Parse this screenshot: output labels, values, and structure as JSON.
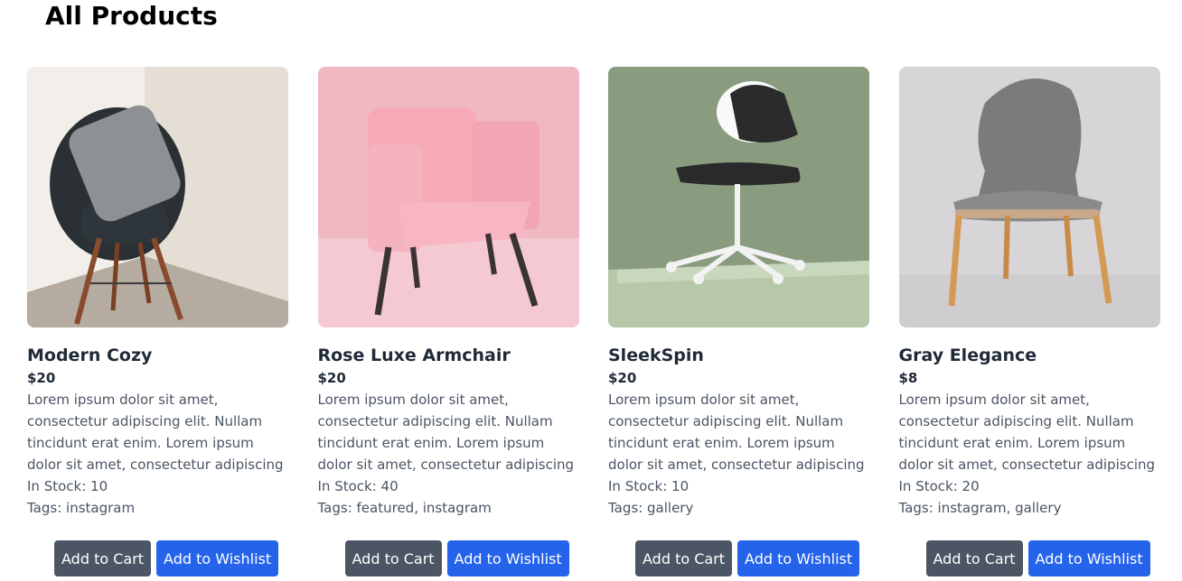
{
  "page": {
    "title": "All Products"
  },
  "colors": {
    "cart_button": "#4b5563",
    "wishlist_button": "#2563eb",
    "product_name": "#1f2937",
    "body_text": "#4b5563"
  },
  "products": [
    {
      "name": "Modern Cozy",
      "price": "$20",
      "description": "Lorem ipsum dolor sit amet, consectetur adipiscing elit. Nullam tincidunt erat enim. Lorem ipsum dolor sit amet, consectetur adipiscing",
      "stock": "In Stock: 10",
      "tags": "Tags: instagram",
      "cart_label": "Add to Cart",
      "wishlist_label": "Add to Wishlist",
      "image": "black-shell-chair-with-gray-pillow"
    },
    {
      "name": "Rose Luxe Armchair",
      "price": "$20",
      "description": "Lorem ipsum dolor sit amet, consectetur adipiscing elit. Nullam tincidunt erat enim. Lorem ipsum dolor sit amet, consectetur adipiscing",
      "stock": "In Stock: 40",
      "tags": "Tags: featured, instagram",
      "cart_label": "Add to Cart",
      "wishlist_label": "Add to Wishlist",
      "image": "pink-tufted-armchair"
    },
    {
      "name": "SleekSpin",
      "price": "$20",
      "description": "Lorem ipsum dolor sit amet, consectetur adipiscing elit. Nullam tincidunt erat enim. Lorem ipsum dolor sit amet, consectetur adipiscing",
      "stock": "In Stock: 10",
      "tags": "Tags: gallery",
      "cart_label": "Add to Cart",
      "wishlist_label": "Add to Wishlist",
      "image": "white-swivel-office-chair"
    },
    {
      "name": "Gray Elegance",
      "price": "$8",
      "description": "Lorem ipsum dolor sit amet, consectetur adipiscing elit. Nullam tincidunt erat enim. Lorem ipsum dolor sit amet, consectetur adipiscing",
      "stock": "In Stock: 20",
      "tags": "Tags: instagram, gallery",
      "cart_label": "Add to Cart",
      "wishlist_label": "Add to Wishlist",
      "image": "gray-upholstered-dining-chair"
    }
  ]
}
